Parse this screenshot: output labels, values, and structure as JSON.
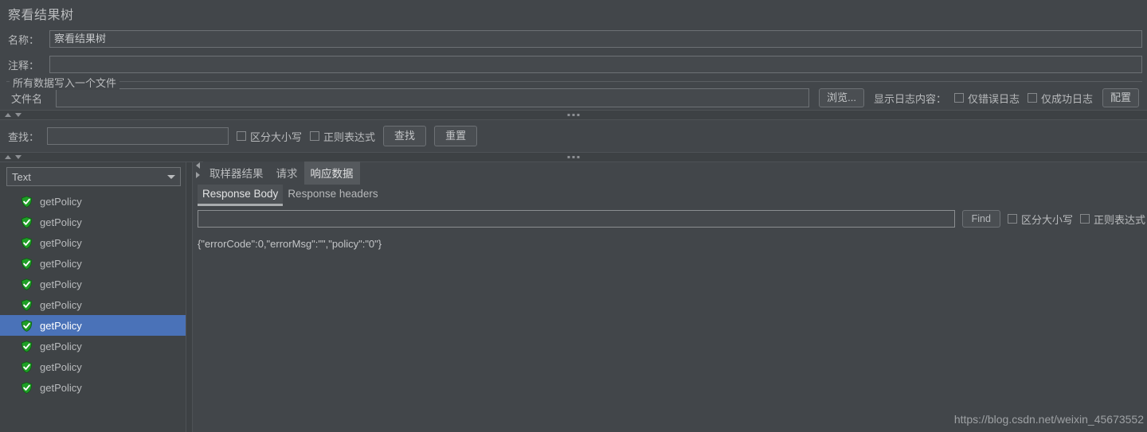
{
  "window": {
    "title": "察看结果树"
  },
  "form": {
    "name_label": "名称：",
    "name_value": "察看结果树",
    "comment_label": "注释：",
    "comment_value": "",
    "comment_placeholder": ""
  },
  "file_group": {
    "legend": "所有数据写入一个文件",
    "filename_label": "文件名",
    "filename_value": "",
    "browse_button": "浏览...",
    "log_content_label": "显示日志内容：",
    "errors_only_label": "仅错误日志",
    "errors_only_checked": false,
    "success_only_label": "仅成功日志",
    "success_only_checked": false,
    "configure_button": "配置"
  },
  "search_bar": {
    "label": "查找：",
    "value": "",
    "case_sensitive_label": "区分大小写",
    "case_sensitive_checked": false,
    "regex_label": "正则表达式",
    "regex_checked": false,
    "find_button": "查找",
    "reset_button": "重置"
  },
  "left_pane": {
    "renderer_selected": "Text",
    "tree_items": [
      {
        "label": "getPolicy",
        "status": "success",
        "selected": false
      },
      {
        "label": "getPolicy",
        "status": "success",
        "selected": false
      },
      {
        "label": "getPolicy",
        "status": "success",
        "selected": false
      },
      {
        "label": "getPolicy",
        "status": "success",
        "selected": false
      },
      {
        "label": "getPolicy",
        "status": "success",
        "selected": false
      },
      {
        "label": "getPolicy",
        "status": "success",
        "selected": false
      },
      {
        "label": "getPolicy",
        "status": "success",
        "selected": true
      },
      {
        "label": "getPolicy",
        "status": "success",
        "selected": false
      },
      {
        "label": "getPolicy",
        "status": "success",
        "selected": false
      },
      {
        "label": "getPolicy",
        "status": "success",
        "selected": false
      }
    ]
  },
  "right_pane": {
    "tabs": [
      {
        "label": "取样器结果",
        "active": false
      },
      {
        "label": "请求",
        "active": false
      },
      {
        "label": "响应数据",
        "active": true
      }
    ],
    "subtabs": [
      {
        "label": "Response Body",
        "active": true
      },
      {
        "label": "Response headers",
        "active": false
      }
    ],
    "find": {
      "value": "",
      "button": "Find",
      "case_sensitive_label": "区分大小写",
      "case_sensitive_checked": false,
      "regex_label": "正则表达式",
      "regex_checked": false
    },
    "response_body": "{\"errorCode\":0,\"errorMsg\":\"\",\"policy\":\"0\"}"
  },
  "watermark": "https://blog.csdn.net/weixin_45673552",
  "colors": {
    "background": "#42464a",
    "panel": "#3f4346",
    "selection": "#4a72b8",
    "text": "#b9bbbd",
    "success_green": "#22a02a",
    "border": "#6d7175"
  }
}
